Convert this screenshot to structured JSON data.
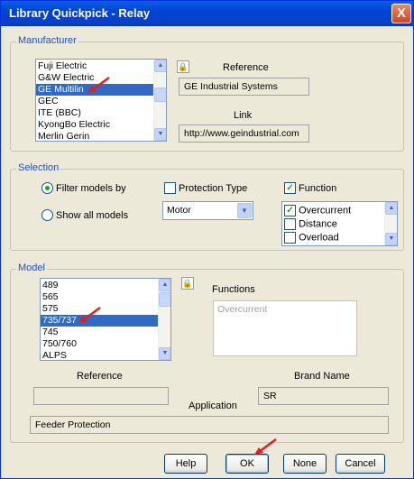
{
  "window": {
    "title": "Library Quickpick - Relay",
    "close": "X"
  },
  "manufacturer": {
    "group_label": "Manufacturer",
    "items": [
      "Fuji Electric",
      "G&W Electric",
      "GE Multilin",
      "GEC",
      "ITE (BBC)",
      "KyongBo Electric",
      "Merlin Gerin"
    ],
    "selected": "GE Multilin",
    "reference_label": "Reference",
    "reference_value": "GE Industrial Systems",
    "link_label": "Link",
    "link_value": "http://www.geindustrial.com"
  },
  "selection": {
    "group_label": "Selection",
    "filter_models_by": "Filter models by",
    "show_all_models": "Show all models",
    "selected_radio": "Filter models by",
    "protection_type_label": "Protection Type",
    "protection_type_checked": false,
    "function_label": "Function",
    "function_checked": true,
    "protection_type_value": "Motor",
    "function_items": [
      {
        "label": "Overcurrent",
        "checked": true
      },
      {
        "label": "Distance",
        "checked": false
      },
      {
        "label": "Overload",
        "checked": false
      }
    ]
  },
  "model": {
    "group_label": "Model",
    "items": [
      "489",
      "565",
      "575",
      "735/737",
      "745",
      "750/760",
      "ALPS"
    ],
    "selected": "735/737",
    "functions_label": "Functions",
    "functions_value": "Overcurrent",
    "reference_label": "Reference",
    "brand_name_label": "Brand Name",
    "brand_name_value": "SR",
    "application_label": "Application",
    "application_value": "Feeder Protection"
  },
  "buttons": {
    "help": "Help",
    "ok": "OK",
    "none": "None",
    "cancel": "Cancel"
  },
  "colors": {
    "accent": "#316ac5",
    "title_bar": "#0a5fe6",
    "annotation_arrow": "#e0201e"
  }
}
